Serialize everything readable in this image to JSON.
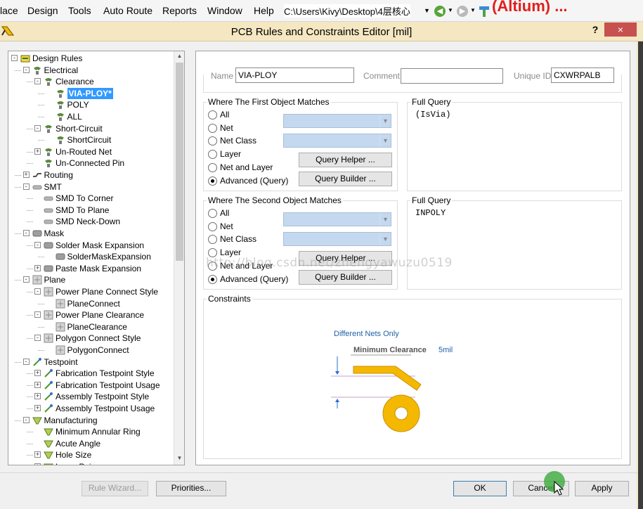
{
  "menubar": {
    "items": [
      "lace",
      "Design",
      "Tools",
      "Auto Route",
      "Reports",
      "Window",
      "Help"
    ],
    "path": "C:\\Users\\Kivy\\Desktop\\4层核心",
    "overlay": "(Altium) ..."
  },
  "dialog": {
    "title": "PCB Rules and Constraints Editor [mil]",
    "help": "?",
    "close": "×"
  },
  "tree": {
    "items": [
      {
        "label": "Design Rules",
        "icon": "design-rules-icon"
      },
      {
        "label": "Electrical",
        "icon": "electrical-icon"
      },
      {
        "label": "Clearance",
        "icon": "clearance-icon"
      },
      {
        "label": "VIA-PLOY*",
        "icon": "rule-icon",
        "selected": true
      },
      {
        "label": "POLY",
        "icon": "rule-icon"
      },
      {
        "label": "ALL",
        "icon": "rule-icon"
      },
      {
        "label": "Short-Circuit",
        "icon": "short-circuit-icon"
      },
      {
        "label": "ShortCircuit",
        "icon": "rule-icon"
      },
      {
        "label": "Un-Routed Net",
        "icon": "unrouted-net-icon"
      },
      {
        "label": "Un-Connected Pin",
        "icon": "unconnected-pin-icon"
      },
      {
        "label": "Routing",
        "icon": "routing-icon"
      },
      {
        "label": "SMT",
        "icon": "smt-icon"
      },
      {
        "label": "SMD To Corner",
        "icon": "smd-icon"
      },
      {
        "label": "SMD To Plane",
        "icon": "smd-icon"
      },
      {
        "label": "SMD Neck-Down",
        "icon": "smd-icon"
      },
      {
        "label": "Mask",
        "icon": "mask-icon"
      },
      {
        "label": "Solder Mask Expansion",
        "icon": "mask-icon"
      },
      {
        "label": "SolderMaskExpansion",
        "icon": "mask-icon"
      },
      {
        "label": "Paste Mask Expansion",
        "icon": "mask-icon"
      },
      {
        "label": "Plane",
        "icon": "plane-icon"
      },
      {
        "label": "Power Plane Connect Style",
        "icon": "plane-icon"
      },
      {
        "label": "PlaneConnect",
        "icon": "plane-icon"
      },
      {
        "label": "Power Plane Clearance",
        "icon": "plane-icon"
      },
      {
        "label": "PlaneClearance",
        "icon": "plane-icon"
      },
      {
        "label": "Polygon Connect Style",
        "icon": "plane-icon"
      },
      {
        "label": "PolygonConnect",
        "icon": "plane-icon"
      },
      {
        "label": "Testpoint",
        "icon": "testpoint-icon"
      },
      {
        "label": "Fabrication Testpoint Style",
        "icon": "testpoint-icon"
      },
      {
        "label": "Fabrication Testpoint Usage",
        "icon": "testpoint-icon"
      },
      {
        "label": "Assembly Testpoint Style",
        "icon": "testpoint-icon"
      },
      {
        "label": "Assembly Testpoint Usage",
        "icon": "testpoint-icon"
      },
      {
        "label": "Manufacturing",
        "icon": "manufacturing-icon"
      },
      {
        "label": "Minimum Annular Ring",
        "icon": "manufacturing-icon"
      },
      {
        "label": "Acute Angle",
        "icon": "manufacturing-icon"
      },
      {
        "label": "Hole Size",
        "icon": "manufacturing-icon"
      },
      {
        "label": "Layer Pairs",
        "icon": "manufacturing-icon"
      }
    ]
  },
  "rule": {
    "name_label": "Name",
    "name_value": "VIA-PLOY",
    "comment_label": "Comment",
    "comment_value": "",
    "uid_label": "Unique ID",
    "uid_value": "CXWRPALB"
  },
  "first": {
    "title": "Where The First Object Matches",
    "options": [
      "All",
      "Net",
      "Net Class",
      "Layer",
      "Net and Layer",
      "Advanced (Query)"
    ],
    "selected": "Advanced (Query)",
    "query_helper": "Query Helper ...",
    "query_builder": "Query Builder ...",
    "full_query_title": "Full Query",
    "full_query": "(IsVia)"
  },
  "second": {
    "title": "Where The Second Object Matches",
    "options": [
      "All",
      "Net",
      "Net Class",
      "Layer",
      "Net and Layer",
      "Advanced (Query)"
    ],
    "selected": "Advanced (Query)",
    "query_helper": "Query Helper ...",
    "query_builder": "Query Builder ...",
    "full_query_title": "Full Query",
    "full_query": "INPOLY"
  },
  "constraints": {
    "title": "Constraints",
    "net_scope": "Different Nets Only",
    "min_clearance_label": "Minimum Clearance",
    "min_clearance_value": "5mil",
    "colors": {
      "copper": "#f5b800",
      "link": "#1f5fa8"
    }
  },
  "buttons": {
    "rule_wizard": "Rule Wizard...",
    "priorities": "Priorities...",
    "ok": "OK",
    "cancel": "Cancel",
    "apply": "Apply"
  },
  "watermark": "http://blog.csdn.net/zhengyawuzu0519"
}
